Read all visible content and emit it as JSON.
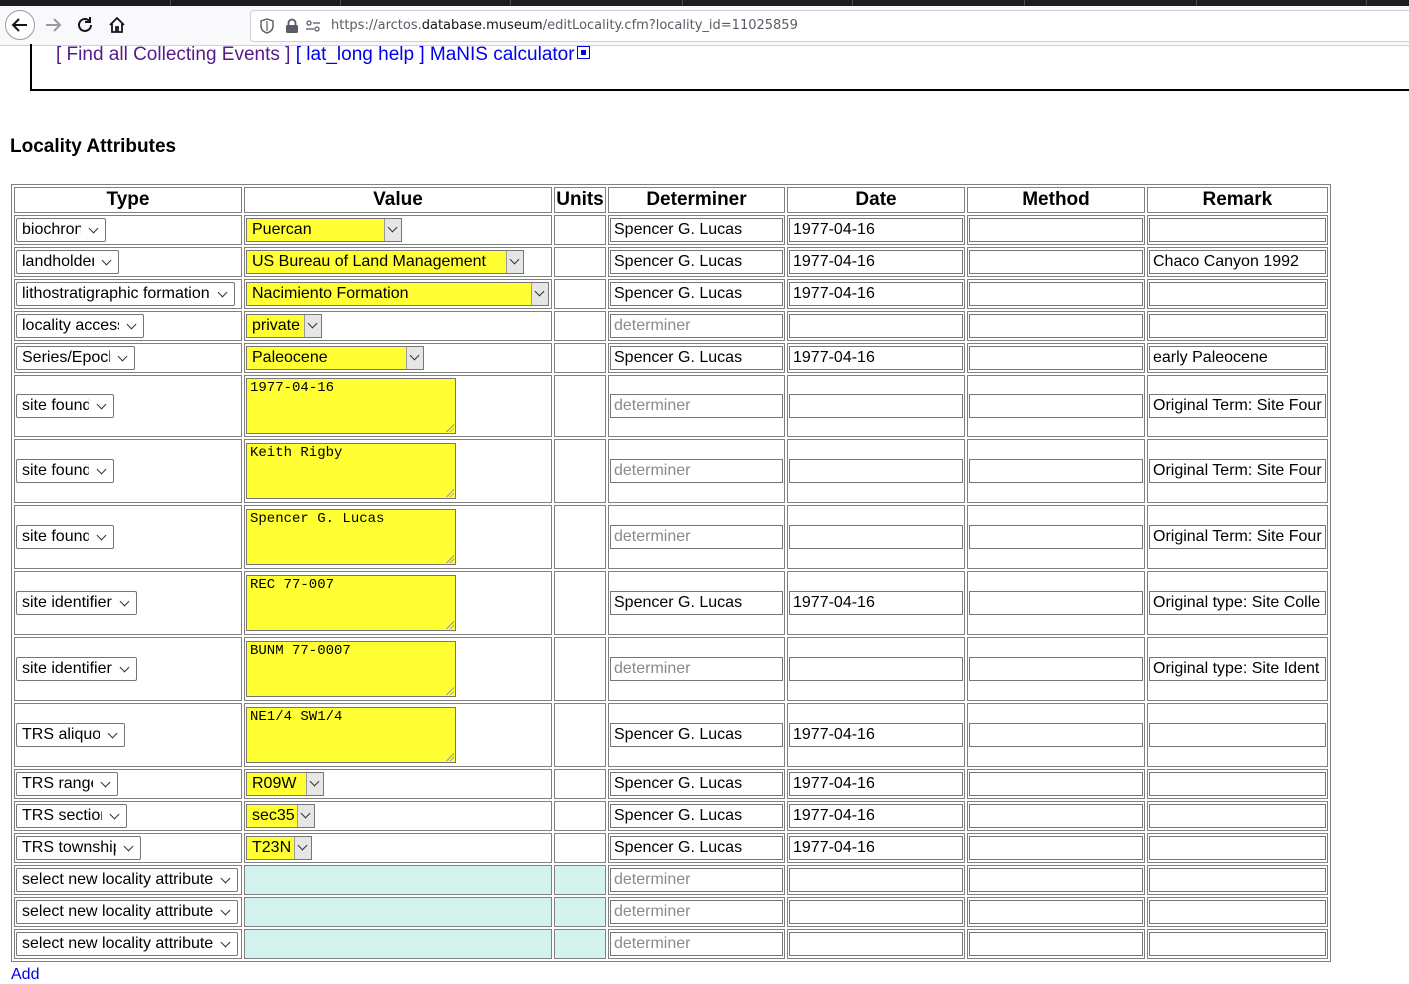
{
  "browser": {
    "url_prefix": "https://arctos.",
    "url_domain": "database.museum",
    "url_path": "/editLocality.cfm?locality_id=11025859"
  },
  "links": {
    "find_events": "[ Find all Collecting Events ]",
    "latlong_help": "[ lat_long help ]",
    "manis": "MaNIS calculator"
  },
  "section_title": "Locality Attributes",
  "table": {
    "headers": {
      "type": "Type",
      "value": "Value",
      "units": "Units",
      "determiner": "Determiner",
      "date": "Date",
      "method": "Method",
      "remark": "Remark"
    },
    "placeholders": {
      "determiner": "determiner"
    },
    "rows": [
      {
        "type": "biochron",
        "value": "Puercan",
        "determiner": "Spencer G. Lucas",
        "date": "1977-04-16",
        "method": "",
        "remark": ""
      },
      {
        "type": "landholder",
        "value": "US Bureau of Land Management",
        "determiner": "Spencer G. Lucas",
        "date": "1977-04-16",
        "method": "",
        "remark": "Chaco Canyon 1992"
      },
      {
        "type": "lithostratigraphic formation",
        "value": "Nacimiento Formation",
        "determiner": "Spencer G. Lucas",
        "date": "1977-04-16",
        "method": "",
        "remark": ""
      },
      {
        "type": "locality access",
        "value": "private",
        "determiner": "",
        "date": "",
        "method": "",
        "remark": ""
      },
      {
        "type": "Series/Epoch",
        "value": "Paleocene",
        "determiner": "Spencer G. Lucas",
        "date": "1977-04-16",
        "method": "",
        "remark": "early Paleocene"
      },
      {
        "type": "site found",
        "value": "1977-04-16",
        "determiner": "",
        "date": "",
        "method": "",
        "remark": "Original Term: Site Four"
      },
      {
        "type": "site found",
        "value": "Keith Rigby",
        "determiner": "",
        "date": "",
        "method": "",
        "remark": "Original Term: Site Four"
      },
      {
        "type": "site found",
        "value": "Spencer G. Lucas",
        "determiner": "",
        "date": "",
        "method": "",
        "remark": "Original Term: Site Four"
      },
      {
        "type": "site identifier",
        "value": "REC 77-007",
        "determiner": "Spencer G. Lucas",
        "date": "1977-04-16",
        "method": "",
        "remark": "Original type: Site Colle"
      },
      {
        "type": "site identifier",
        "value": "BUNM 77-0007",
        "determiner": "",
        "date": "",
        "method": "",
        "remark": "Original type: Site Ident"
      },
      {
        "type": "TRS aliquot",
        "value": "NE1/4 SW1/4",
        "determiner": "Spencer G. Lucas",
        "date": "1977-04-16",
        "method": "",
        "remark": ""
      },
      {
        "type": "TRS range",
        "value": "R09W",
        "determiner": "Spencer G. Lucas",
        "date": "1977-04-16",
        "method": "",
        "remark": ""
      },
      {
        "type": "TRS section",
        "value": "sec35",
        "determiner": "Spencer G. Lucas",
        "date": "1977-04-16",
        "method": "",
        "remark": ""
      },
      {
        "type": "TRS township",
        "value": "T23N",
        "determiner": "Spencer G. Lucas",
        "date": "1977-04-16",
        "method": "",
        "remark": ""
      },
      {
        "type": "select new locality attribute",
        "value": "",
        "determiner": "",
        "date": "",
        "method": "",
        "remark": ""
      },
      {
        "type": "select new locality attribute",
        "value": "",
        "determiner": "",
        "date": "",
        "method": "",
        "remark": ""
      },
      {
        "type": "select new locality attribute",
        "value": "",
        "determiner": "",
        "date": "",
        "method": "",
        "remark": ""
      }
    ]
  },
  "add_link": "Add"
}
